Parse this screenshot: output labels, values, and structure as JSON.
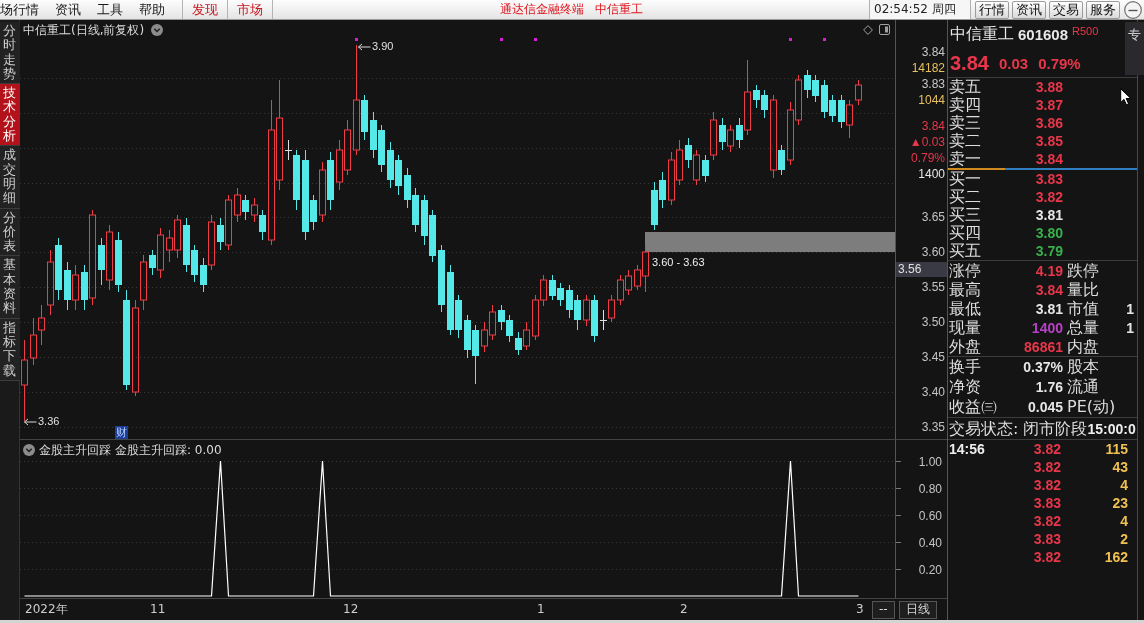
{
  "menu_bar": {
    "menus": [
      "场行情",
      "资讯",
      "工具",
      "帮助"
    ],
    "links": [
      "发现",
      "市场"
    ],
    "app_title": "通达信金融终端",
    "stock_title": "中信重工",
    "clock": "02:54:52 周四",
    "buttons": [
      "行情",
      "资讯",
      "交易",
      "服务"
    ]
  },
  "side_tabs": [
    {
      "label": "分时走势",
      "selected": false
    },
    {
      "label": "技术分析",
      "selected": true
    },
    {
      "label": "成交明细",
      "selected": false
    },
    {
      "label": "分价表",
      "selected": false
    },
    {
      "label": "基本资料",
      "selected": false
    },
    {
      "label": "指标下载",
      "selected": false
    }
  ],
  "price_chart": {
    "title": "中信重工(日线,前复权)",
    "high_label": "3.90",
    "low_label": "3.36",
    "range_label": "3.60 - 3.63",
    "badge": "财",
    "axis_overlay": [
      {
        "entries": [
          {
            "text": "3.84",
            "color": "#c8c8c8"
          },
          {
            "text": "14182",
            "color": "#e8c060"
          },
          {
            "text": "3.83",
            "color": "#c8c8c8"
          },
          {
            "text": "1044",
            "color": "#e8c060"
          }
        ]
      },
      {
        "entries": [
          {
            "text": "3.84",
            "color": "#e8364a"
          },
          {
            "text": "▲0.03",
            "color": "#e8364a"
          },
          {
            "text": "0.79%",
            "color": "#e8364a"
          },
          {
            "text": "1400",
            "color": "#e6e6e6"
          }
        ]
      }
    ],
    "axis_labels": [
      "3.65",
      "3.60",
      "3.55",
      "3.50",
      "3.45",
      "3.40",
      "3.35"
    ],
    "cursor_price": "3.56"
  },
  "indicator": {
    "legend": "金股主升回踩: 0.00",
    "chart_data": {
      "type": "line",
      "title": "金股主升回踩",
      "series": [
        {
          "color": "#ffffff",
          "values": [
            0,
            0,
            0,
            0,
            0,
            0,
            0,
            0,
            0,
            0,
            0,
            0,
            0,
            0,
            0,
            0,
            0,
            0,
            0,
            0,
            0,
            0,
            0,
            1,
            0,
            0,
            0,
            0,
            0,
            0,
            0,
            0,
            0,
            0,
            0,
            1,
            0,
            0,
            0,
            0,
            0,
            0,
            0,
            0,
            0,
            0,
            0,
            0,
            0,
            0,
            0,
            0,
            0,
            0,
            0,
            0,
            0,
            0,
            0,
            0,
            0,
            0,
            0,
            0,
            0,
            0,
            0,
            0,
            0,
            0,
            0,
            0,
            0,
            0,
            0,
            0,
            0,
            0,
            0,
            0,
            0,
            0,
            0,
            0,
            0,
            0,
            0,
            0,
            0,
            0,
            1,
            0,
            0,
            0,
            0,
            0,
            0,
            0,
            0
          ]
        }
      ],
      "ylim": [
        0,
        1
      ],
      "yticks": [
        {
          "value": 1,
          "label": "1.00"
        },
        {
          "value": 0.8,
          "label": "0.80"
        },
        {
          "value": 0.6,
          "label": "0.60"
        },
        {
          "value": 0.4,
          "label": "0.40"
        },
        {
          "value": 0.2,
          "label": "0.20"
        }
      ],
      "grid": true
    }
  },
  "time_axis": {
    "labels": [
      "2022年",
      "11",
      "12",
      "1",
      "2",
      "3"
    ],
    "buttons": [
      "--",
      "日线"
    ]
  },
  "quote": {
    "name": "中信重工",
    "code": "601608",
    "tag": "R500",
    "side_button": "专",
    "price": "3.84",
    "change": "0.03",
    "change_pct": "0.79%",
    "asks": [
      {
        "label": "卖五",
        "price": "3.88",
        "color": "#e8364a"
      },
      {
        "label": "卖四",
        "price": "3.87",
        "color": "#e8364a"
      },
      {
        "label": "卖三",
        "price": "3.86",
        "color": "#e8364a"
      },
      {
        "label": "卖二",
        "price": "3.85",
        "color": "#e8364a"
      },
      {
        "label": "卖一",
        "price": "3.84",
        "color": "#e8364a"
      }
    ],
    "balance": {
      "level": 0.3
    },
    "bids": [
      {
        "label": "买一",
        "price": "3.83",
        "color": "#e8364a"
      },
      {
        "label": "买二",
        "price": "3.82",
        "color": "#e8364a"
      },
      {
        "label": "买三",
        "price": "3.81",
        "color": "#e6e6e6"
      },
      {
        "label": "买四",
        "price": "3.80",
        "color": "#38b04c"
      },
      {
        "label": "买五",
        "price": "3.79",
        "color": "#38b04c"
      }
    ],
    "stats": [
      {
        "label": "涨停",
        "value": "4.19",
        "color": "#e8364a",
        "label_2": "跌停"
      },
      {
        "label": "最高",
        "value": "3.84",
        "color": "#e8364a",
        "label_2": "量比"
      },
      {
        "label": "最低",
        "value": "3.81",
        "color": "#e6e6e6",
        "label_2": "市值",
        "value_2": "1"
      },
      {
        "label": "现量",
        "value": "1400",
        "color": "#b840c8",
        "label_2": "总量",
        "value_2": "1"
      },
      {
        "label": "外盘",
        "value": "86861",
        "color": "#e8364a",
        "label_2": "内盘"
      }
    ],
    "fundamentals": [
      {
        "label": "换手",
        "value": "0.37%",
        "label_2": "股本"
      },
      {
        "label": "净资",
        "value": "1.76",
        "label_2": "流通"
      },
      {
        "label": "收益㈢",
        "value": "0.045",
        "label_2": "PE(动)"
      }
    ],
    "status": "交易状态: 闭市阶段",
    "status_time": "15:00:0",
    "ticks": [
      {
        "time": "14:56",
        "price": "3.82",
        "volume": "115"
      },
      {
        "price": "3.82",
        "volume": "43"
      },
      {
        "price": "3.82",
        "volume": "4"
      },
      {
        "price": "3.83",
        "volume": "23"
      },
      {
        "price": "3.82",
        "volume": "4"
      },
      {
        "price": "3.83",
        "volume": "2"
      },
      {
        "price": "3.82",
        "volume": "162"
      }
    ]
  }
}
